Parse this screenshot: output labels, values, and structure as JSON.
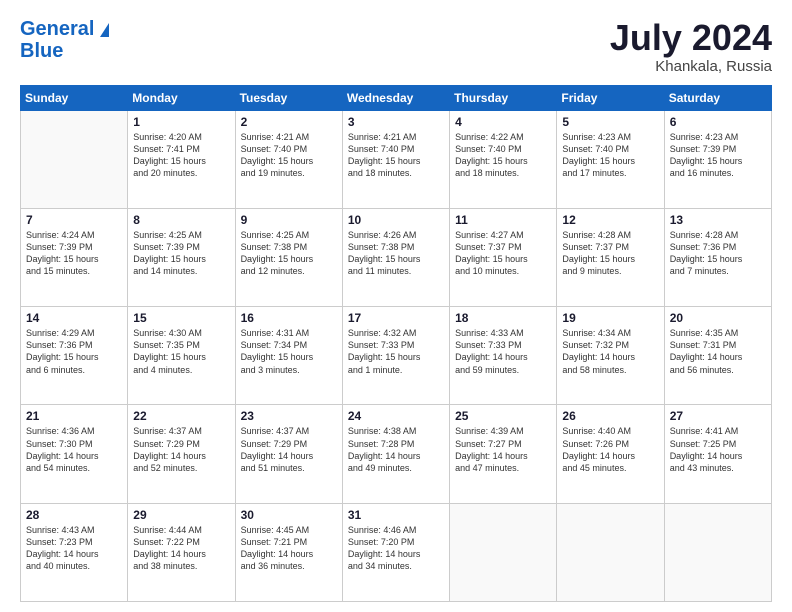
{
  "header": {
    "logo_general": "General",
    "logo_blue": "Blue",
    "month_title": "July 2024",
    "location": "Khankala, Russia"
  },
  "weekdays": [
    "Sunday",
    "Monday",
    "Tuesday",
    "Wednesday",
    "Thursday",
    "Friday",
    "Saturday"
  ],
  "weeks": [
    [
      {
        "day": "",
        "info": ""
      },
      {
        "day": "1",
        "info": "Sunrise: 4:20 AM\nSunset: 7:41 PM\nDaylight: 15 hours\nand 20 minutes."
      },
      {
        "day": "2",
        "info": "Sunrise: 4:21 AM\nSunset: 7:40 PM\nDaylight: 15 hours\nand 19 minutes."
      },
      {
        "day": "3",
        "info": "Sunrise: 4:21 AM\nSunset: 7:40 PM\nDaylight: 15 hours\nand 18 minutes."
      },
      {
        "day": "4",
        "info": "Sunrise: 4:22 AM\nSunset: 7:40 PM\nDaylight: 15 hours\nand 18 minutes."
      },
      {
        "day": "5",
        "info": "Sunrise: 4:23 AM\nSunset: 7:40 PM\nDaylight: 15 hours\nand 17 minutes."
      },
      {
        "day": "6",
        "info": "Sunrise: 4:23 AM\nSunset: 7:39 PM\nDaylight: 15 hours\nand 16 minutes."
      }
    ],
    [
      {
        "day": "7",
        "info": "Sunrise: 4:24 AM\nSunset: 7:39 PM\nDaylight: 15 hours\nand 15 minutes."
      },
      {
        "day": "8",
        "info": "Sunrise: 4:25 AM\nSunset: 7:39 PM\nDaylight: 15 hours\nand 14 minutes."
      },
      {
        "day": "9",
        "info": "Sunrise: 4:25 AM\nSunset: 7:38 PM\nDaylight: 15 hours\nand 12 minutes."
      },
      {
        "day": "10",
        "info": "Sunrise: 4:26 AM\nSunset: 7:38 PM\nDaylight: 15 hours\nand 11 minutes."
      },
      {
        "day": "11",
        "info": "Sunrise: 4:27 AM\nSunset: 7:37 PM\nDaylight: 15 hours\nand 10 minutes."
      },
      {
        "day": "12",
        "info": "Sunrise: 4:28 AM\nSunset: 7:37 PM\nDaylight: 15 hours\nand 9 minutes."
      },
      {
        "day": "13",
        "info": "Sunrise: 4:28 AM\nSunset: 7:36 PM\nDaylight: 15 hours\nand 7 minutes."
      }
    ],
    [
      {
        "day": "14",
        "info": "Sunrise: 4:29 AM\nSunset: 7:36 PM\nDaylight: 15 hours\nand 6 minutes."
      },
      {
        "day": "15",
        "info": "Sunrise: 4:30 AM\nSunset: 7:35 PM\nDaylight: 15 hours\nand 4 minutes."
      },
      {
        "day": "16",
        "info": "Sunrise: 4:31 AM\nSunset: 7:34 PM\nDaylight: 15 hours\nand 3 minutes."
      },
      {
        "day": "17",
        "info": "Sunrise: 4:32 AM\nSunset: 7:33 PM\nDaylight: 15 hours\nand 1 minute."
      },
      {
        "day": "18",
        "info": "Sunrise: 4:33 AM\nSunset: 7:33 PM\nDaylight: 14 hours\nand 59 minutes."
      },
      {
        "day": "19",
        "info": "Sunrise: 4:34 AM\nSunset: 7:32 PM\nDaylight: 14 hours\nand 58 minutes."
      },
      {
        "day": "20",
        "info": "Sunrise: 4:35 AM\nSunset: 7:31 PM\nDaylight: 14 hours\nand 56 minutes."
      }
    ],
    [
      {
        "day": "21",
        "info": "Sunrise: 4:36 AM\nSunset: 7:30 PM\nDaylight: 14 hours\nand 54 minutes."
      },
      {
        "day": "22",
        "info": "Sunrise: 4:37 AM\nSunset: 7:29 PM\nDaylight: 14 hours\nand 52 minutes."
      },
      {
        "day": "23",
        "info": "Sunrise: 4:37 AM\nSunset: 7:29 PM\nDaylight: 14 hours\nand 51 minutes."
      },
      {
        "day": "24",
        "info": "Sunrise: 4:38 AM\nSunset: 7:28 PM\nDaylight: 14 hours\nand 49 minutes."
      },
      {
        "day": "25",
        "info": "Sunrise: 4:39 AM\nSunset: 7:27 PM\nDaylight: 14 hours\nand 47 minutes."
      },
      {
        "day": "26",
        "info": "Sunrise: 4:40 AM\nSunset: 7:26 PM\nDaylight: 14 hours\nand 45 minutes."
      },
      {
        "day": "27",
        "info": "Sunrise: 4:41 AM\nSunset: 7:25 PM\nDaylight: 14 hours\nand 43 minutes."
      }
    ],
    [
      {
        "day": "28",
        "info": "Sunrise: 4:43 AM\nSunset: 7:23 PM\nDaylight: 14 hours\nand 40 minutes."
      },
      {
        "day": "29",
        "info": "Sunrise: 4:44 AM\nSunset: 7:22 PM\nDaylight: 14 hours\nand 38 minutes."
      },
      {
        "day": "30",
        "info": "Sunrise: 4:45 AM\nSunset: 7:21 PM\nDaylight: 14 hours\nand 36 minutes."
      },
      {
        "day": "31",
        "info": "Sunrise: 4:46 AM\nSunset: 7:20 PM\nDaylight: 14 hours\nand 34 minutes."
      },
      {
        "day": "",
        "info": ""
      },
      {
        "day": "",
        "info": ""
      },
      {
        "day": "",
        "info": ""
      }
    ]
  ]
}
